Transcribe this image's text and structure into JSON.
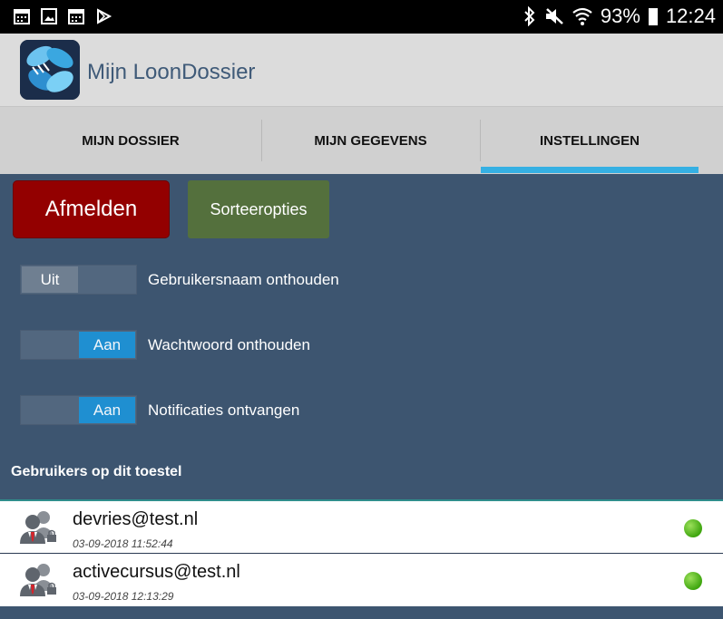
{
  "status_bar": {
    "icons_left": [
      "calendar-icon",
      "image-icon",
      "calendar-icon",
      "play-store-icon"
    ],
    "icons_right": [
      "bluetooth-icon",
      "mute-icon",
      "wifi-icon"
    ],
    "battery": "93%",
    "time": "12:24"
  },
  "app": {
    "title": "Mijn LoonDossier"
  },
  "tabs": [
    {
      "label": "MIJN DOSSIER",
      "active": false
    },
    {
      "label": "MIJN GEGEVENS",
      "active": false
    },
    {
      "label": "INSTELLINGEN",
      "active": true
    }
  ],
  "buttons": {
    "logout": "Afmelden",
    "sort": "Sorteeropties"
  },
  "settings": [
    {
      "state_label": "Uit",
      "on": false,
      "label": "Gebruikersnaam onthouden"
    },
    {
      "state_label": "Aan",
      "on": true,
      "label": "Wachtwoord onthouden"
    },
    {
      "state_label": "Aan",
      "on": true,
      "label": "Notificaties ontvangen"
    }
  ],
  "users_section": {
    "title": "Gebruikers op dit toestel",
    "users": [
      {
        "email": "devries@test.nl",
        "date": "03-09-2018 11:52:44"
      },
      {
        "email": "activecursus@test.nl",
        "date": "03-09-2018 12:13:29"
      }
    ]
  },
  "colors": {
    "background": "#3d5570",
    "accent": "#35b0e3",
    "logout": "#930000",
    "sort": "#54703d",
    "toggle_on": "#1f8fd1",
    "status_dot": "#3fa60f"
  }
}
